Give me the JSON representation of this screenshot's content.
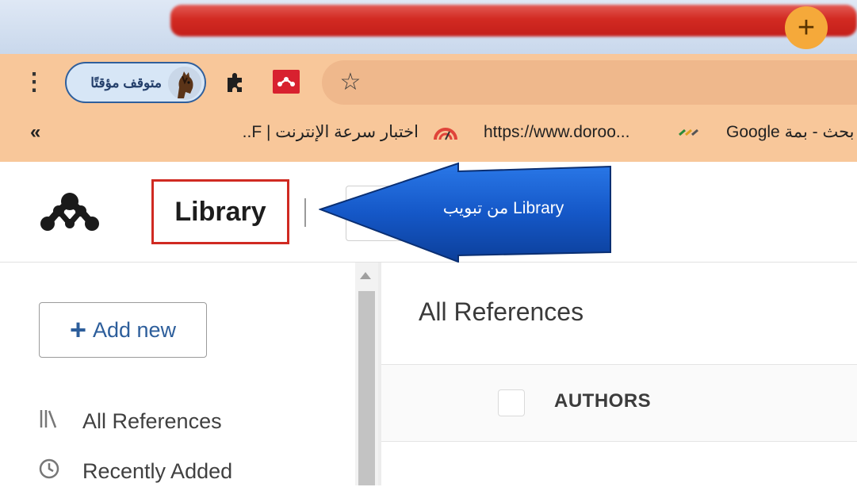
{
  "browser": {
    "new_tab_symbol": "+",
    "menu_symbol": "⋮",
    "profile_label": "متوقف مؤقتًا",
    "star_symbol": "☆",
    "bookmarks": {
      "more_symbol": "«",
      "items": [
        {
          "label": "اختبار سرعة الإنترنت | F..."
        },
        {
          "label": "https://www.doroo..."
        },
        {
          "label": "Google بحث - بمة"
        }
      ]
    },
    "colors": {
      "tab_accent": "#d22a22",
      "toolbar": "#f8c79a",
      "new_tab": "#f5a93a"
    }
  },
  "app": {
    "nav_library": "Library",
    "callout_text": "من تبويب  Library",
    "add_new_symbol": "+",
    "add_new_label": "Add new",
    "sidebar": {
      "items": [
        {
          "label": "All References",
          "icon": "library-icon"
        },
        {
          "label": "Recently Added",
          "icon": "clock-icon"
        }
      ]
    },
    "main_title": "All References",
    "table": {
      "columns": [
        "AUTHORS"
      ]
    },
    "colors": {
      "highlight_border": "#d02a22",
      "callout": "#1558c8",
      "accent_text": "#2d5e9b"
    }
  }
}
